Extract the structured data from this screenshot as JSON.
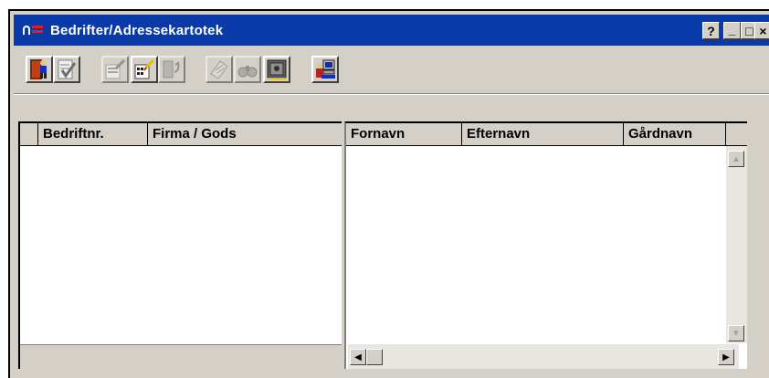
{
  "window": {
    "title": "Bedrifter/Adressekartotek",
    "help_label": "?",
    "minimize_label": "_",
    "maximize_label": "□",
    "close_label": "×"
  },
  "toolbar": {
    "buttons": [
      {
        "name": "exit",
        "icon": "exit-door-icon"
      },
      {
        "name": "approve",
        "icon": "checklist-icon"
      },
      {
        "name": "edit-record",
        "icon": "edit-record-icon"
      },
      {
        "name": "new-record",
        "icon": "new-record-icon"
      },
      {
        "name": "undo",
        "icon": "undo-icon"
      },
      {
        "name": "notes",
        "icon": "notes-icon"
      },
      {
        "name": "search",
        "icon": "binoculars-icon"
      },
      {
        "name": "safe",
        "icon": "safe-icon"
      },
      {
        "name": "user-computer",
        "icon": "user-computer-icon"
      }
    ]
  },
  "left_grid": {
    "columns": [
      "",
      "Bedriftnr.",
      "Firma / Gods"
    ]
  },
  "right_grid": {
    "columns": [
      "Fornavn",
      "Efternavn",
      "Gårdnavn"
    ]
  },
  "scroll": {
    "left_arrow": "◀",
    "right_arrow": "▶",
    "up_arrow": "▲",
    "down_arrow": "▼"
  },
  "colors": {
    "title_bar": "#0a3aa8",
    "face": "#d4d0c8",
    "icon_red": "#e02020"
  }
}
